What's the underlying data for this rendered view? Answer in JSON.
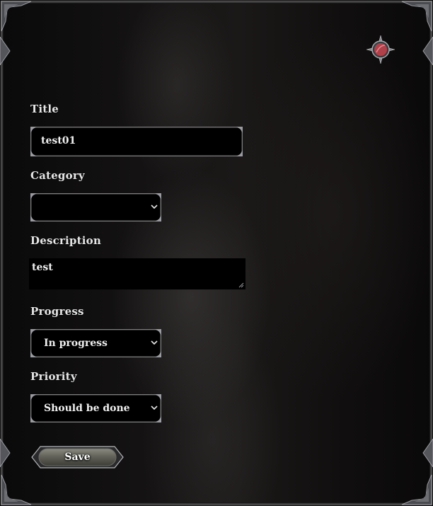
{
  "form": {
    "title_label": "Title",
    "title_value": "test01",
    "category_label": "Category",
    "category_value": "",
    "description_label": "Description",
    "description_value": "test",
    "progress_label": "Progress",
    "progress_value": "In progress",
    "priority_label": "Priority",
    "priority_value": "Should be done",
    "save_label": "Save"
  },
  "icons": {
    "orb": "red-orb-icon",
    "select_arrow": "chevron-down-icon"
  },
  "colors": {
    "field_bg": "#000000",
    "field_border": "#7e7e80",
    "text": "#e6e6e6",
    "orb": "#b0404a"
  }
}
